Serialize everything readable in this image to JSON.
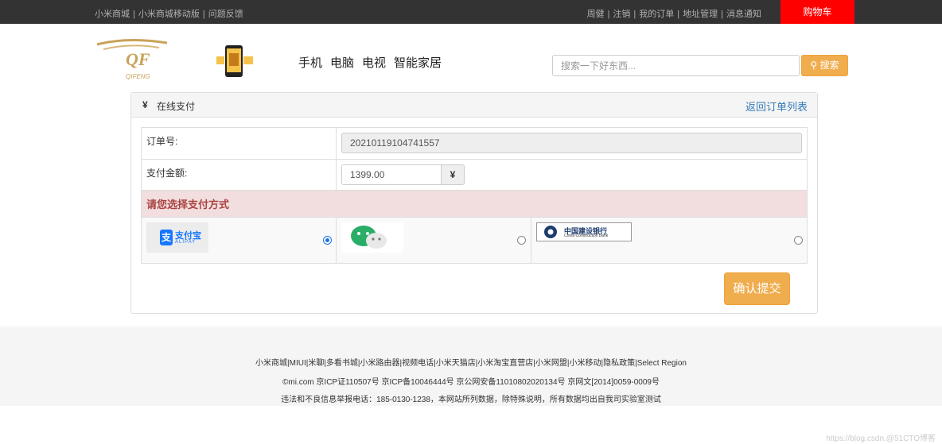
{
  "topbar": {
    "left_links": [
      "小米商城",
      "小米商城移动版",
      "问题反馈"
    ],
    "right_links": [
      "周健",
      "注销",
      "我的订单",
      "地址管理",
      "消息通知"
    ],
    "cart_label": "购物车"
  },
  "header": {
    "logo_text": "QF",
    "logo_subtext": "QIFENG",
    "nav": [
      "手机",
      "电脑",
      "电视",
      "智能家居"
    ],
    "search_placeholder": "搜索一下好东西...",
    "search_button": "搜索"
  },
  "panel": {
    "title_icon": "¥",
    "title": "在线支付",
    "back_link": "返回订单列表",
    "order_label": "订单号:",
    "order_number": "20210119104741557",
    "amount_label": "支付金额:",
    "amount_value": "1399.00",
    "amount_addon": "¥",
    "choose_label": "请您选择支付方式",
    "payment_methods": [
      {
        "name": "alipay",
        "label": "支付宝",
        "sub": "ALIPAY",
        "checked": true
      },
      {
        "name": "wechat",
        "label": "",
        "checked": false
      },
      {
        "name": "ccb",
        "label": "中国建设银行",
        "sub": "China Construction Bank",
        "checked": false
      }
    ],
    "confirm_button": "确认提交"
  },
  "footer": {
    "links": "小米商城|MIUI|米聊|多看书城|小米路由器|视频电话|小米天猫店|小米淘宝直营店|小米网盟|小米移动|隐私政策|Select Region",
    "icp": "©mi.com 京ICP证110507号 京ICP备10046444号 京公网安备11010802020134号 京网文[2014]0059-0009号",
    "notice": "违法和不良信息举报电话：185-0130-1238，本网站所列数据，除特殊说明，所有数据均出自我司实验室测试"
  },
  "watermark": "https://blog.csdn.@51CTO博客",
  "colors": {
    "accent": "#f0ad4e",
    "cart": "#ff0000",
    "topbar": "#333333",
    "link": "#337ab7"
  }
}
